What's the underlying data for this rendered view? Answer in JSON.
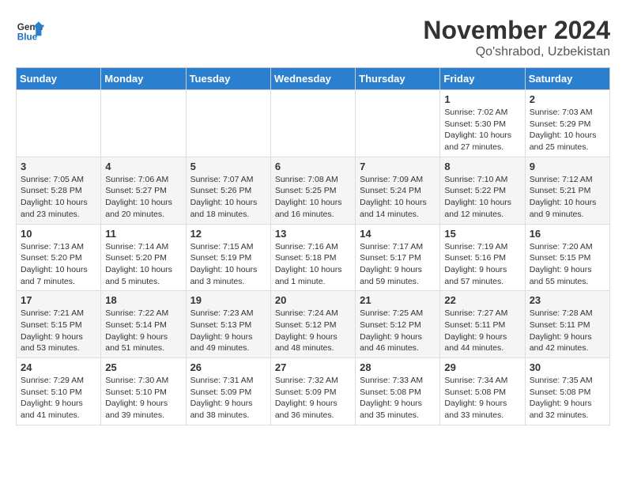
{
  "header": {
    "logo_line1": "General",
    "logo_line2": "Blue",
    "month": "November 2024",
    "location": "Qo'shrabod, Uzbekistan"
  },
  "weekdays": [
    "Sunday",
    "Monday",
    "Tuesday",
    "Wednesday",
    "Thursday",
    "Friday",
    "Saturday"
  ],
  "weeks": [
    [
      {
        "day": "",
        "info": ""
      },
      {
        "day": "",
        "info": ""
      },
      {
        "day": "",
        "info": ""
      },
      {
        "day": "",
        "info": ""
      },
      {
        "day": "",
        "info": ""
      },
      {
        "day": "1",
        "info": "Sunrise: 7:02 AM\nSunset: 5:30 PM\nDaylight: 10 hours and 27 minutes."
      },
      {
        "day": "2",
        "info": "Sunrise: 7:03 AM\nSunset: 5:29 PM\nDaylight: 10 hours and 25 minutes."
      }
    ],
    [
      {
        "day": "3",
        "info": "Sunrise: 7:05 AM\nSunset: 5:28 PM\nDaylight: 10 hours and 23 minutes."
      },
      {
        "day": "4",
        "info": "Sunrise: 7:06 AM\nSunset: 5:27 PM\nDaylight: 10 hours and 20 minutes."
      },
      {
        "day": "5",
        "info": "Sunrise: 7:07 AM\nSunset: 5:26 PM\nDaylight: 10 hours and 18 minutes."
      },
      {
        "day": "6",
        "info": "Sunrise: 7:08 AM\nSunset: 5:25 PM\nDaylight: 10 hours and 16 minutes."
      },
      {
        "day": "7",
        "info": "Sunrise: 7:09 AM\nSunset: 5:24 PM\nDaylight: 10 hours and 14 minutes."
      },
      {
        "day": "8",
        "info": "Sunrise: 7:10 AM\nSunset: 5:22 PM\nDaylight: 10 hours and 12 minutes."
      },
      {
        "day": "9",
        "info": "Sunrise: 7:12 AM\nSunset: 5:21 PM\nDaylight: 10 hours and 9 minutes."
      }
    ],
    [
      {
        "day": "10",
        "info": "Sunrise: 7:13 AM\nSunset: 5:20 PM\nDaylight: 10 hours and 7 minutes."
      },
      {
        "day": "11",
        "info": "Sunrise: 7:14 AM\nSunset: 5:20 PM\nDaylight: 10 hours and 5 minutes."
      },
      {
        "day": "12",
        "info": "Sunrise: 7:15 AM\nSunset: 5:19 PM\nDaylight: 10 hours and 3 minutes."
      },
      {
        "day": "13",
        "info": "Sunrise: 7:16 AM\nSunset: 5:18 PM\nDaylight: 10 hours and 1 minute."
      },
      {
        "day": "14",
        "info": "Sunrise: 7:17 AM\nSunset: 5:17 PM\nDaylight: 9 hours and 59 minutes."
      },
      {
        "day": "15",
        "info": "Sunrise: 7:19 AM\nSunset: 5:16 PM\nDaylight: 9 hours and 57 minutes."
      },
      {
        "day": "16",
        "info": "Sunrise: 7:20 AM\nSunset: 5:15 PM\nDaylight: 9 hours and 55 minutes."
      }
    ],
    [
      {
        "day": "17",
        "info": "Sunrise: 7:21 AM\nSunset: 5:15 PM\nDaylight: 9 hours and 53 minutes."
      },
      {
        "day": "18",
        "info": "Sunrise: 7:22 AM\nSunset: 5:14 PM\nDaylight: 9 hours and 51 minutes."
      },
      {
        "day": "19",
        "info": "Sunrise: 7:23 AM\nSunset: 5:13 PM\nDaylight: 9 hours and 49 minutes."
      },
      {
        "day": "20",
        "info": "Sunrise: 7:24 AM\nSunset: 5:12 PM\nDaylight: 9 hours and 48 minutes."
      },
      {
        "day": "21",
        "info": "Sunrise: 7:25 AM\nSunset: 5:12 PM\nDaylight: 9 hours and 46 minutes."
      },
      {
        "day": "22",
        "info": "Sunrise: 7:27 AM\nSunset: 5:11 PM\nDaylight: 9 hours and 44 minutes."
      },
      {
        "day": "23",
        "info": "Sunrise: 7:28 AM\nSunset: 5:11 PM\nDaylight: 9 hours and 42 minutes."
      }
    ],
    [
      {
        "day": "24",
        "info": "Sunrise: 7:29 AM\nSunset: 5:10 PM\nDaylight: 9 hours and 41 minutes."
      },
      {
        "day": "25",
        "info": "Sunrise: 7:30 AM\nSunset: 5:10 PM\nDaylight: 9 hours and 39 minutes."
      },
      {
        "day": "26",
        "info": "Sunrise: 7:31 AM\nSunset: 5:09 PM\nDaylight: 9 hours and 38 minutes."
      },
      {
        "day": "27",
        "info": "Sunrise: 7:32 AM\nSunset: 5:09 PM\nDaylight: 9 hours and 36 minutes."
      },
      {
        "day": "28",
        "info": "Sunrise: 7:33 AM\nSunset: 5:08 PM\nDaylight: 9 hours and 35 minutes."
      },
      {
        "day": "29",
        "info": "Sunrise: 7:34 AM\nSunset: 5:08 PM\nDaylight: 9 hours and 33 minutes."
      },
      {
        "day": "30",
        "info": "Sunrise: 7:35 AM\nSunset: 5:08 PM\nDaylight: 9 hours and 32 minutes."
      }
    ]
  ]
}
